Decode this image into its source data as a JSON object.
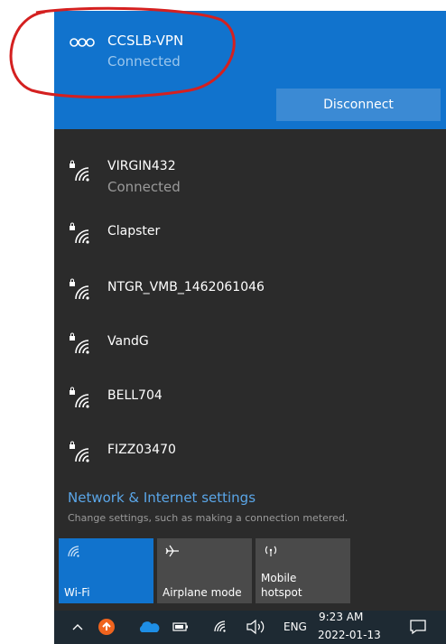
{
  "vpn": {
    "name": "CCSLB-VPN",
    "status": "Connected",
    "disconnect_label": "Disconnect"
  },
  "networks": [
    {
      "name": "VIRGIN432",
      "status": "Connected",
      "secured": true
    },
    {
      "name": "Clapster",
      "status": "",
      "secured": true
    },
    {
      "name": "NTGR_VMB_1462061046",
      "status": "",
      "secured": true
    },
    {
      "name": "VandG",
      "status": "",
      "secured": true
    },
    {
      "name": "BELL704",
      "status": "",
      "secured": true
    },
    {
      "name": "FIZZ03470",
      "status": "",
      "secured": true
    }
  ],
  "settings": {
    "link": "Network & Internet settings",
    "sub": "Change settings, such as making a connection metered."
  },
  "quick_actions": {
    "wifi": "Wi-Fi",
    "airplane": "Airplane mode",
    "hotspot_line1": "Mobile",
    "hotspot_line2": "hotspot"
  },
  "taskbar": {
    "language": "ENG",
    "time": "9:23 AM",
    "date": "2022-01-13"
  },
  "colors": {
    "accent": "#1173cd",
    "panel": "#2b2b2b",
    "annotation": "#d42020"
  },
  "icons": [
    "vpn-icon",
    "wifi-lock-icon",
    "wifi-icon",
    "airplane-icon",
    "hotspot-icon",
    "chevron-up-icon",
    "update-icon",
    "onedrive-icon",
    "battery-icon",
    "volume-icon",
    "notification-icon"
  ]
}
